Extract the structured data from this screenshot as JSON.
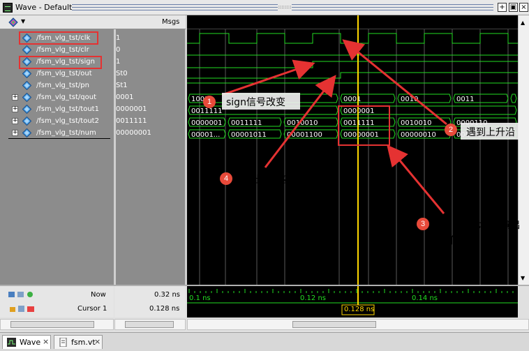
{
  "window": {
    "title": "Wave - Default",
    "grip_dots": "::::::::",
    "buttons": [
      "+",
      "▣",
      "×"
    ]
  },
  "header": {
    "msgs_label": "Msgs"
  },
  "signals": [
    {
      "name": "/fsm_vlg_tst/clk",
      "value": "1",
      "expandable": false
    },
    {
      "name": "/fsm_vlg_tst/clr",
      "value": "0",
      "expandable": false
    },
    {
      "name": "/fsm_vlg_tst/sign",
      "value": "1",
      "expandable": false
    },
    {
      "name": "/fsm_vlg_tst/out",
      "value": "St0",
      "expandable": false
    },
    {
      "name": "/fsm_vlg_tst/pn",
      "value": "St1",
      "expandable": false
    },
    {
      "name": "/fsm_vlg_tst/qout",
      "value": "0001",
      "expandable": true
    },
    {
      "name": "/fsm_vlg_tst/tout1",
      "value": "0000001",
      "expandable": true
    },
    {
      "name": "/fsm_vlg_tst/tout2",
      "value": "0011111",
      "expandable": true
    },
    {
      "name": "/fsm_vlg_tst/num",
      "value": "00000001",
      "expandable": true
    }
  ],
  "bus_labels": {
    "qout": [
      "1001",
      "0001",
      "0010",
      "0011"
    ],
    "tout1": [
      "0011111",
      "0000001"
    ],
    "tout2": [
      "0000001",
      "0011111",
      "0010010",
      "0011111",
      "0010010",
      "0000110"
    ],
    "num": [
      "00001...",
      "00001011",
      "00001100",
      "00000001",
      "00000010",
      "000"
    ]
  },
  "status": {
    "now_label": "Now",
    "now_value": "0.32 ns",
    "cursor_label": "Cursor 1",
    "cursor_value": "0.128 ns",
    "cursor_tag": "0.128 ns",
    "timeline_ticks": [
      "0.1 ns",
      "0.12 ns",
      "0.14 ns"
    ]
  },
  "tabs": [
    {
      "label": "Wave",
      "close": "×"
    },
    {
      "label": "fsm.vt",
      "close": "×"
    }
  ],
  "annotations": [
    {
      "num": "1",
      "text": "sign信号改变"
    },
    {
      "num": "2",
      "text": "遇到上升沿"
    },
    {
      "num": "3",
      "text": "num和七段管输出变化"
    },
    {
      "num": "4",
      "text": "输出发生变化"
    }
  ],
  "colors": {
    "wave_green": "#22dd22",
    "cursor_yellow": "#ffd700",
    "annotation_red": "#e53232",
    "pane_gray": "#8c8c8c"
  }
}
